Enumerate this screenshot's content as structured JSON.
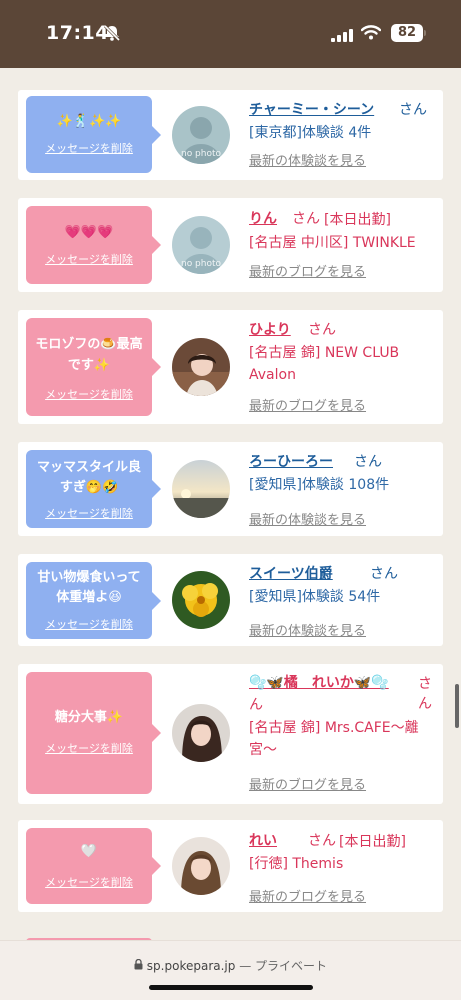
{
  "status_bar": {
    "time": "17:14",
    "battery": "82",
    "icons": [
      "bell-slash-icon",
      "signal-icon",
      "wifi-icon",
      "battery-icon"
    ]
  },
  "colors": {
    "header_bg": "#5b4637",
    "blue_bubble": "#8fb0f0",
    "pink_bubble": "#f49aae",
    "blue_text": "#1e5d9a",
    "pink_text": "#d9365a"
  },
  "delete_label": "メッセージを削除",
  "san": "さん",
  "cards": [
    {
      "message": "✨🕺✨✨",
      "name": "チャーミー・シーン",
      "lines": [
        "[東京都]体験談 4件"
      ],
      "link": "最新の体験談を見る",
      "avatar": "no photo"
    },
    {
      "message": "💗💗💗",
      "name": "りん",
      "tag": "[本日出勤]",
      "lines": [
        "[名古屋 中川区] TWINKLE"
      ],
      "link": "最新のブログを見る",
      "avatar": "no photo"
    },
    {
      "message_lines": [
        "モロゾフの🍮最高",
        "です✨"
      ],
      "name": "ひより",
      "lines": [
        "[名古屋 錦] NEW CLUB",
        "Avalon"
      ],
      "link": "最新のブログを見る"
    },
    {
      "message_lines": [
        "マッマスタイル良",
        "すぎ🤭🤣"
      ],
      "name": "ろーひーろー",
      "lines": [
        "[愛知県]体験談 108件"
      ],
      "link": "最新の体験談を見る"
    },
    {
      "message_lines": [
        "甘い物爆食いって",
        "体重増よ😆"
      ],
      "name": "スイーツ伯爵",
      "lines": [
        "[愛知県]体験談 54件"
      ],
      "link": "最新の体験談を見る"
    },
    {
      "message": "糖分大事✨",
      "name": "🫧🦋橘　れいか🦋🫧",
      "name_line2": "ん",
      "lines": [
        "[名古屋 錦] Mrs.CAFE〜離",
        "宮〜"
      ],
      "link": "最新のブログを見る"
    },
    {
      "message": "🤍",
      "name": "れい",
      "tag": "[本日出勤]",
      "lines": [
        "[行徳] Themis"
      ],
      "link": "最新のブログを見る"
    }
  ],
  "browser": {
    "url": "sp.pokepara.jp",
    "mode": "— プライベート"
  }
}
